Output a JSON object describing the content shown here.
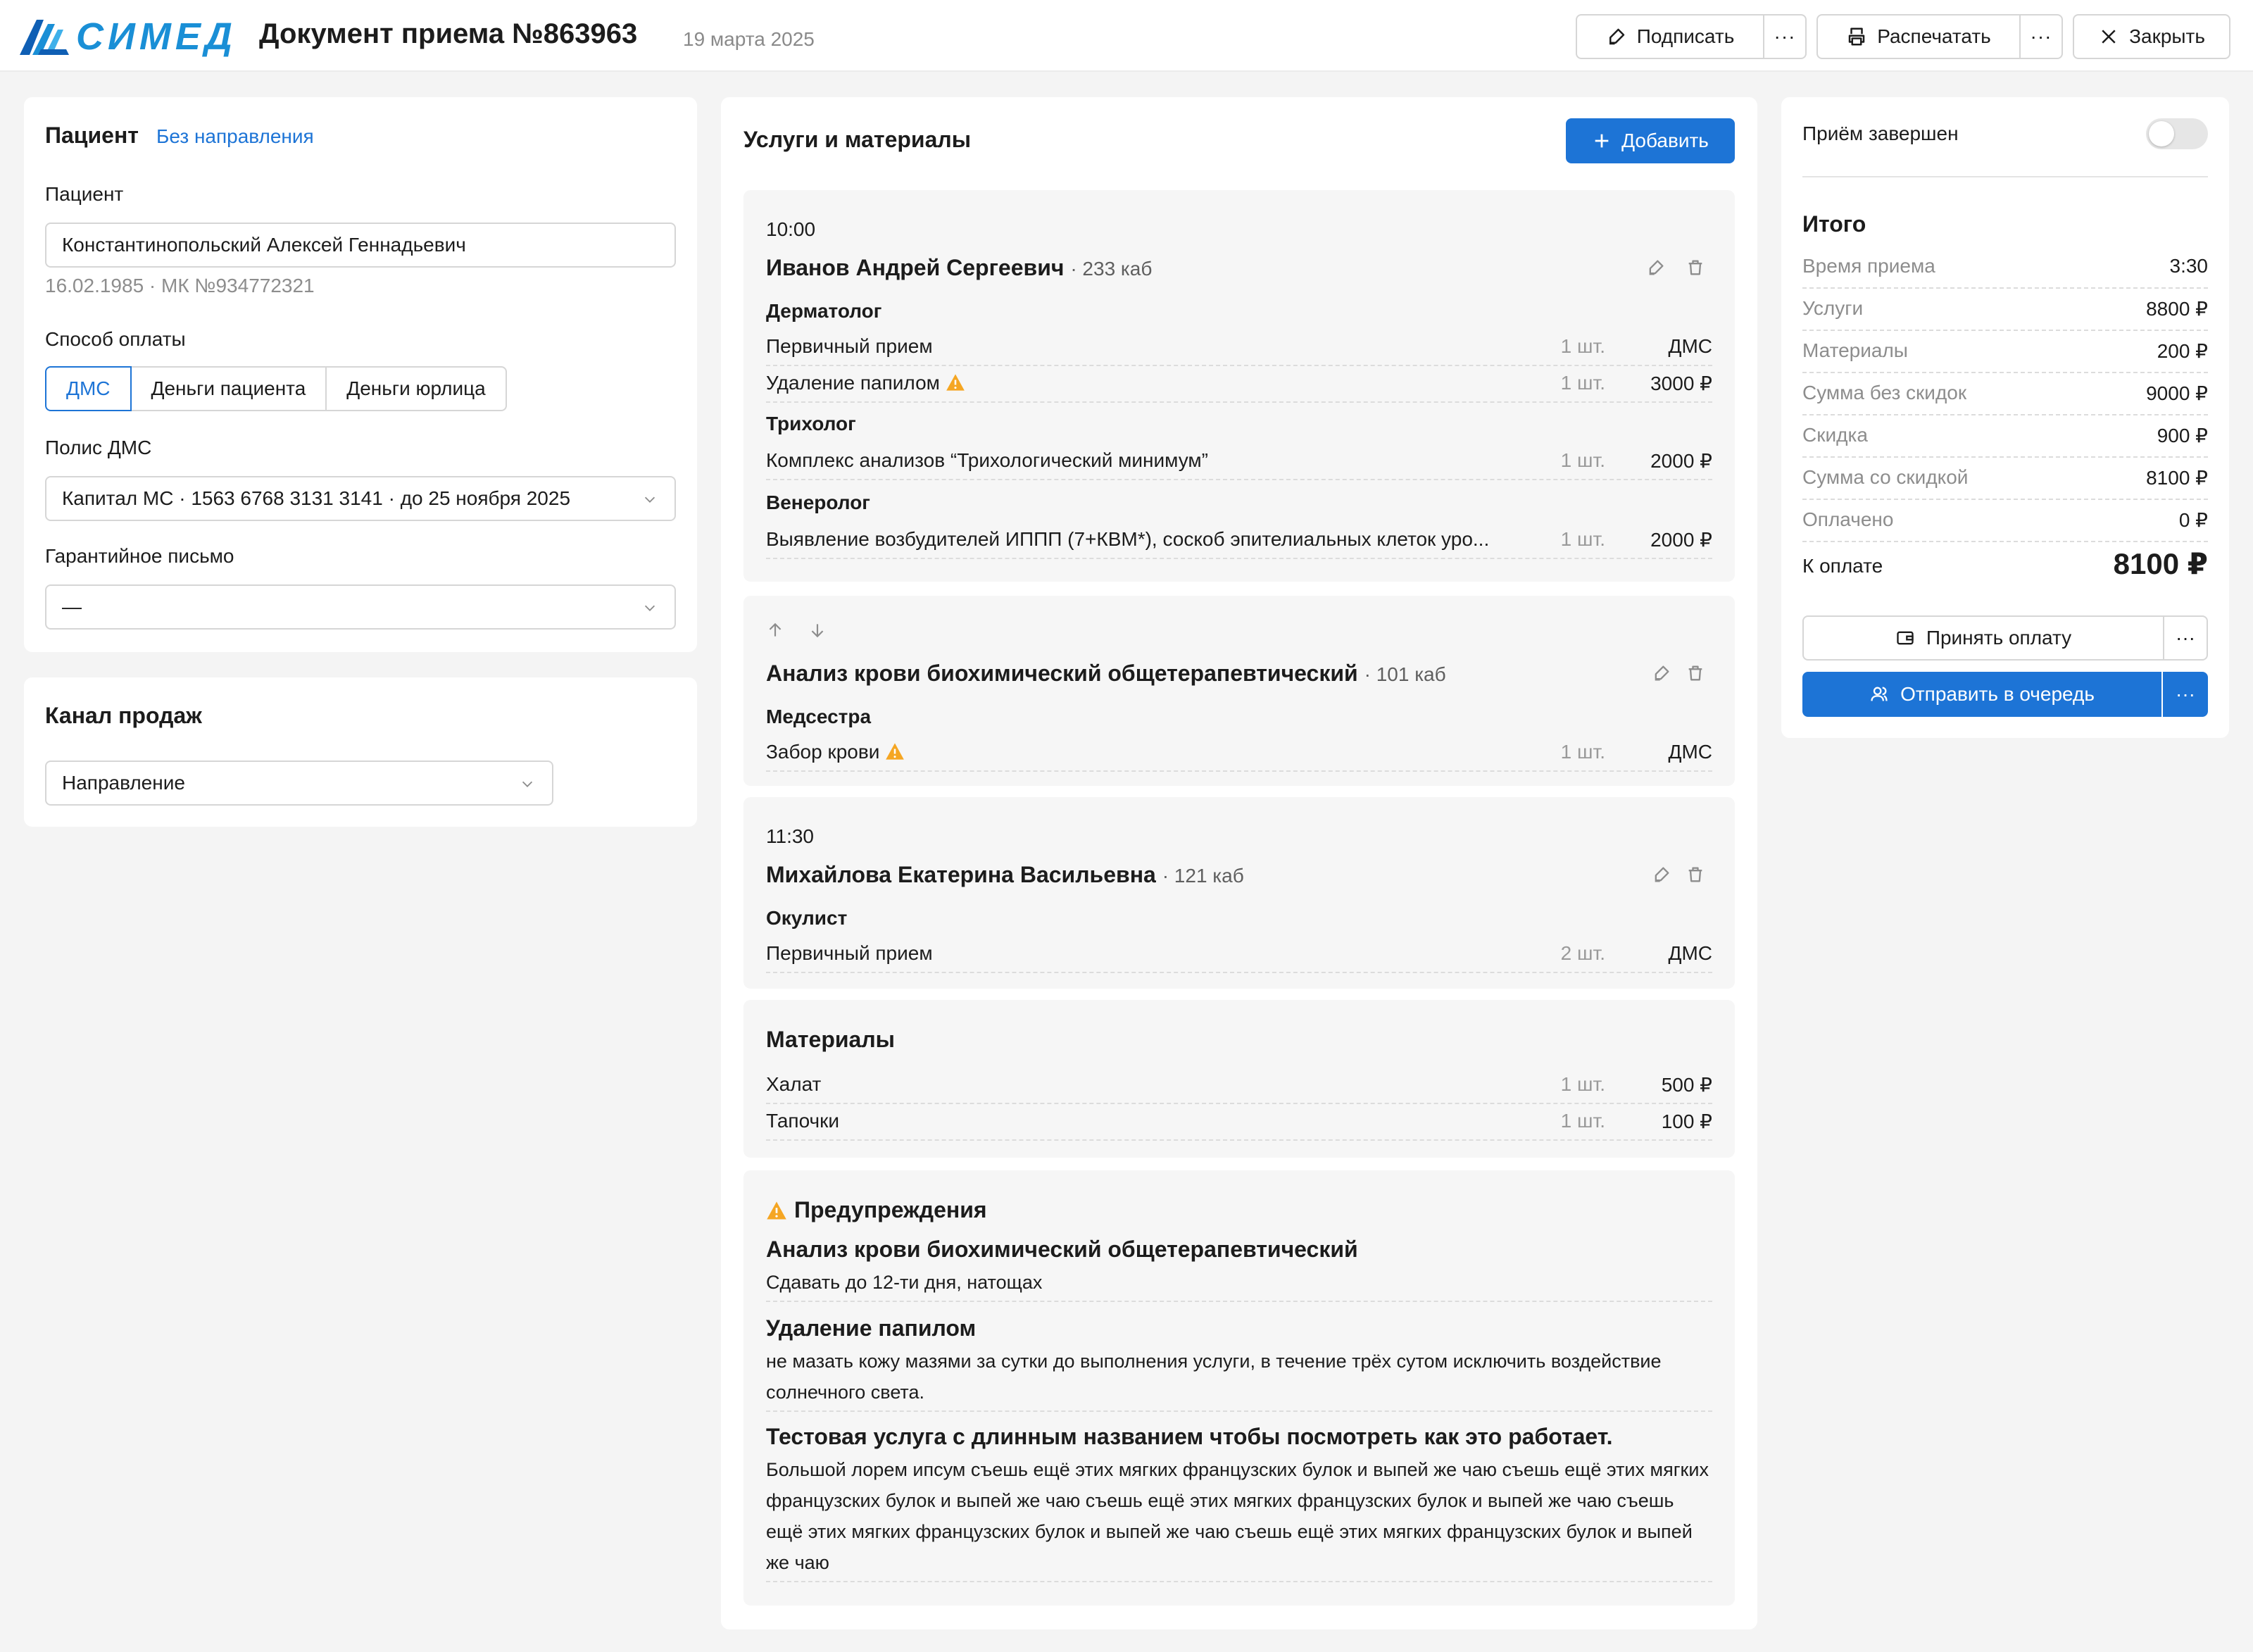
{
  "header": {
    "logo": "СИМЕД",
    "title": "Документ приема №863963",
    "date": "19 марта 2025",
    "sign_label": "Подписать",
    "print_label": "Распечатать",
    "close_label": "Закрыть",
    "more_label": "···"
  },
  "patient": {
    "heading": "Пациент",
    "referral_link": "Без направления",
    "field_label": "Пациент",
    "name": "Константинопольский Алексей Геннадьевич",
    "meta": "16.02.1985 · МК №934772321",
    "payment_label": "Способ оплаты",
    "payment_options": [
      "ДМС",
      "Деньги пациента",
      "Деньги юрлица"
    ],
    "payment_selected": "ДМС",
    "policy_label": "Полис ДМС",
    "policy_value": "Капитал МС · 1563 6768 3131 3141 · до 25 ноября 2025",
    "guarantee_label": "Гарантийное письмо",
    "guarantee_value": "—"
  },
  "sales": {
    "heading": "Канал продаж",
    "value": "Направление"
  },
  "services": {
    "heading": "Услуги и материалы",
    "add_label": "Добавить",
    "blocks": [
      {
        "time": "10:00",
        "doctor": "Иванов Андрей Сергеевич",
        "cab": "· 233 каб",
        "groups": [
          {
            "spec": "Дерматолог",
            "items": [
              {
                "name": "Первичный прием",
                "qty": "1 шт.",
                "price": "ДМС"
              },
              {
                "name": "Удаление папилом",
                "qty": "1 шт.",
                "price": "3000 ₽"
              }
            ]
          },
          {
            "spec": "Трихолог",
            "items": [
              {
                "name": "Комплекс анализов “Трихологический минимум”",
                "qty": "1 шт.",
                "price": "2000 ₽"
              }
            ]
          },
          {
            "spec": "Венеролог",
            "items": [
              {
                "name": "Выявление возбудителей ИППП (7+КВМ*), соскоб эпителиальных клеток уро...",
                "qty": "1 шт.",
                "price": "2000 ₽"
              }
            ]
          }
        ]
      },
      {
        "doctor": "Анализ крови биохимический общетерапевтический",
        "cab": "· 101 каб",
        "groups": [
          {
            "spec": "Медсестра",
            "items": [
              {
                "name": "Забор крови",
                "qty": "1 шт.",
                "price": "ДМС"
              }
            ]
          }
        ]
      },
      {
        "time": "11:30",
        "doctor": "Михайлова Екатерина Васильевна",
        "cab": "· 121 каб",
        "groups": [
          {
            "spec": "Окулист",
            "items": [
              {
                "name": "Первичный прием",
                "qty": "2 шт.",
                "price": "ДМС"
              }
            ]
          }
        ]
      }
    ],
    "materials": {
      "heading": "Материалы",
      "items": [
        {
          "name": "Халат",
          "qty": "1 шт.",
          "price": "500 ₽"
        },
        {
          "name": "Тапочки",
          "qty": "1 шт.",
          "price": "100 ₽"
        }
      ]
    },
    "warnings": {
      "heading": "Предупреждения",
      "items": [
        {
          "title": "Анализ крови биохимический общетерапевтический",
          "text": "Сдавать до 12-ти дня, натощах"
        },
        {
          "title": "Удаление папилом",
          "text": "не мазать кожу мазями за сутки до выполнения услуги, в течение трёх сутом исключить воздействие солнечного света."
        },
        {
          "title": "Тестовая услуга с длинным названием чтобы посмотреть как это работает.",
          "text": "Большой лорем ипсум съешь ещё этих мягких французских булок и выпей же чаю съешь ещё этих мягких французских булок и выпей же чаю съешь ещё этих мягких французских булок и выпей же чаю съешь ещё этих мягких французских булок и выпей же чаю съешь ещё этих мягких французских булок и выпей же чаю"
        }
      ]
    }
  },
  "summary": {
    "completed_label": "Приём завершен",
    "completed": false,
    "heading": "Итого",
    "rows": [
      {
        "key": "Время приема",
        "value": "3:30"
      },
      {
        "key": "Услуги",
        "value": "8800 ₽"
      },
      {
        "key": "Материалы",
        "value": "200 ₽"
      },
      {
        "key": "Сумма без скидок",
        "value": "9000 ₽"
      },
      {
        "key": "Скидка",
        "value": "900 ₽"
      },
      {
        "key": "Сумма со скидкой",
        "value": "8100 ₽"
      },
      {
        "key": "Оплачено",
        "value": "0 ₽"
      }
    ],
    "due_label": "К оплате",
    "due_value": "8100 ₽",
    "pay_label": "Принять оплату",
    "queue_label": "Отправить в очередь"
  },
  "colors": {
    "accent": "#1d74d6",
    "warning": "#f5a623",
    "logo": "#1a8fd6"
  }
}
